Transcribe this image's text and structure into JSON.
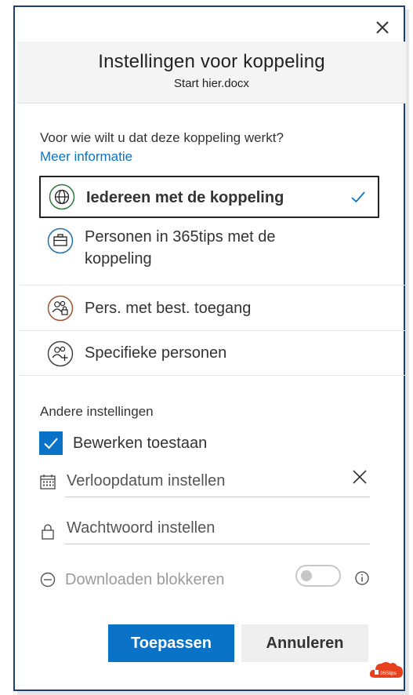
{
  "dialog": {
    "title": "Instellingen voor koppeling",
    "filename": "Start hier.docx"
  },
  "audience": {
    "question": "Voor wie wilt u dat deze koppeling werkt?",
    "more_info": "Meer informatie",
    "options": [
      {
        "label": "Iedereen met de koppeling",
        "icon": "globe-icon",
        "selected": true
      },
      {
        "label": "Personen in 365tips met de koppeling",
        "icon": "briefcase-icon",
        "selected": false
      },
      {
        "label": "Pers. met best. toegang",
        "icon": "people-lock-icon",
        "selected": false
      },
      {
        "label": "Specifieke personen",
        "icon": "people-add-icon",
        "selected": false
      }
    ]
  },
  "other_settings": {
    "title": "Andere instellingen",
    "allow_edit": {
      "label": "Bewerken toestaan",
      "checked": true
    },
    "expiry": {
      "placeholder": "Verloopdatum instellen"
    },
    "password": {
      "placeholder": "Wachtwoord instellen"
    },
    "block_download": {
      "label": "Downloaden blokkeren",
      "enabled": false
    }
  },
  "buttons": {
    "apply": "Toepassen",
    "cancel": "Annuleren"
  },
  "logo": {
    "text": "365tips"
  },
  "colors": {
    "accent": "#0a73c8",
    "globe": "#2a7a3a",
    "briefcase": "#1f6fb0",
    "people_lock": "#a0522d",
    "people_add": "#444444",
    "frame": "#1f3f77",
    "logo": "#e8401c"
  }
}
